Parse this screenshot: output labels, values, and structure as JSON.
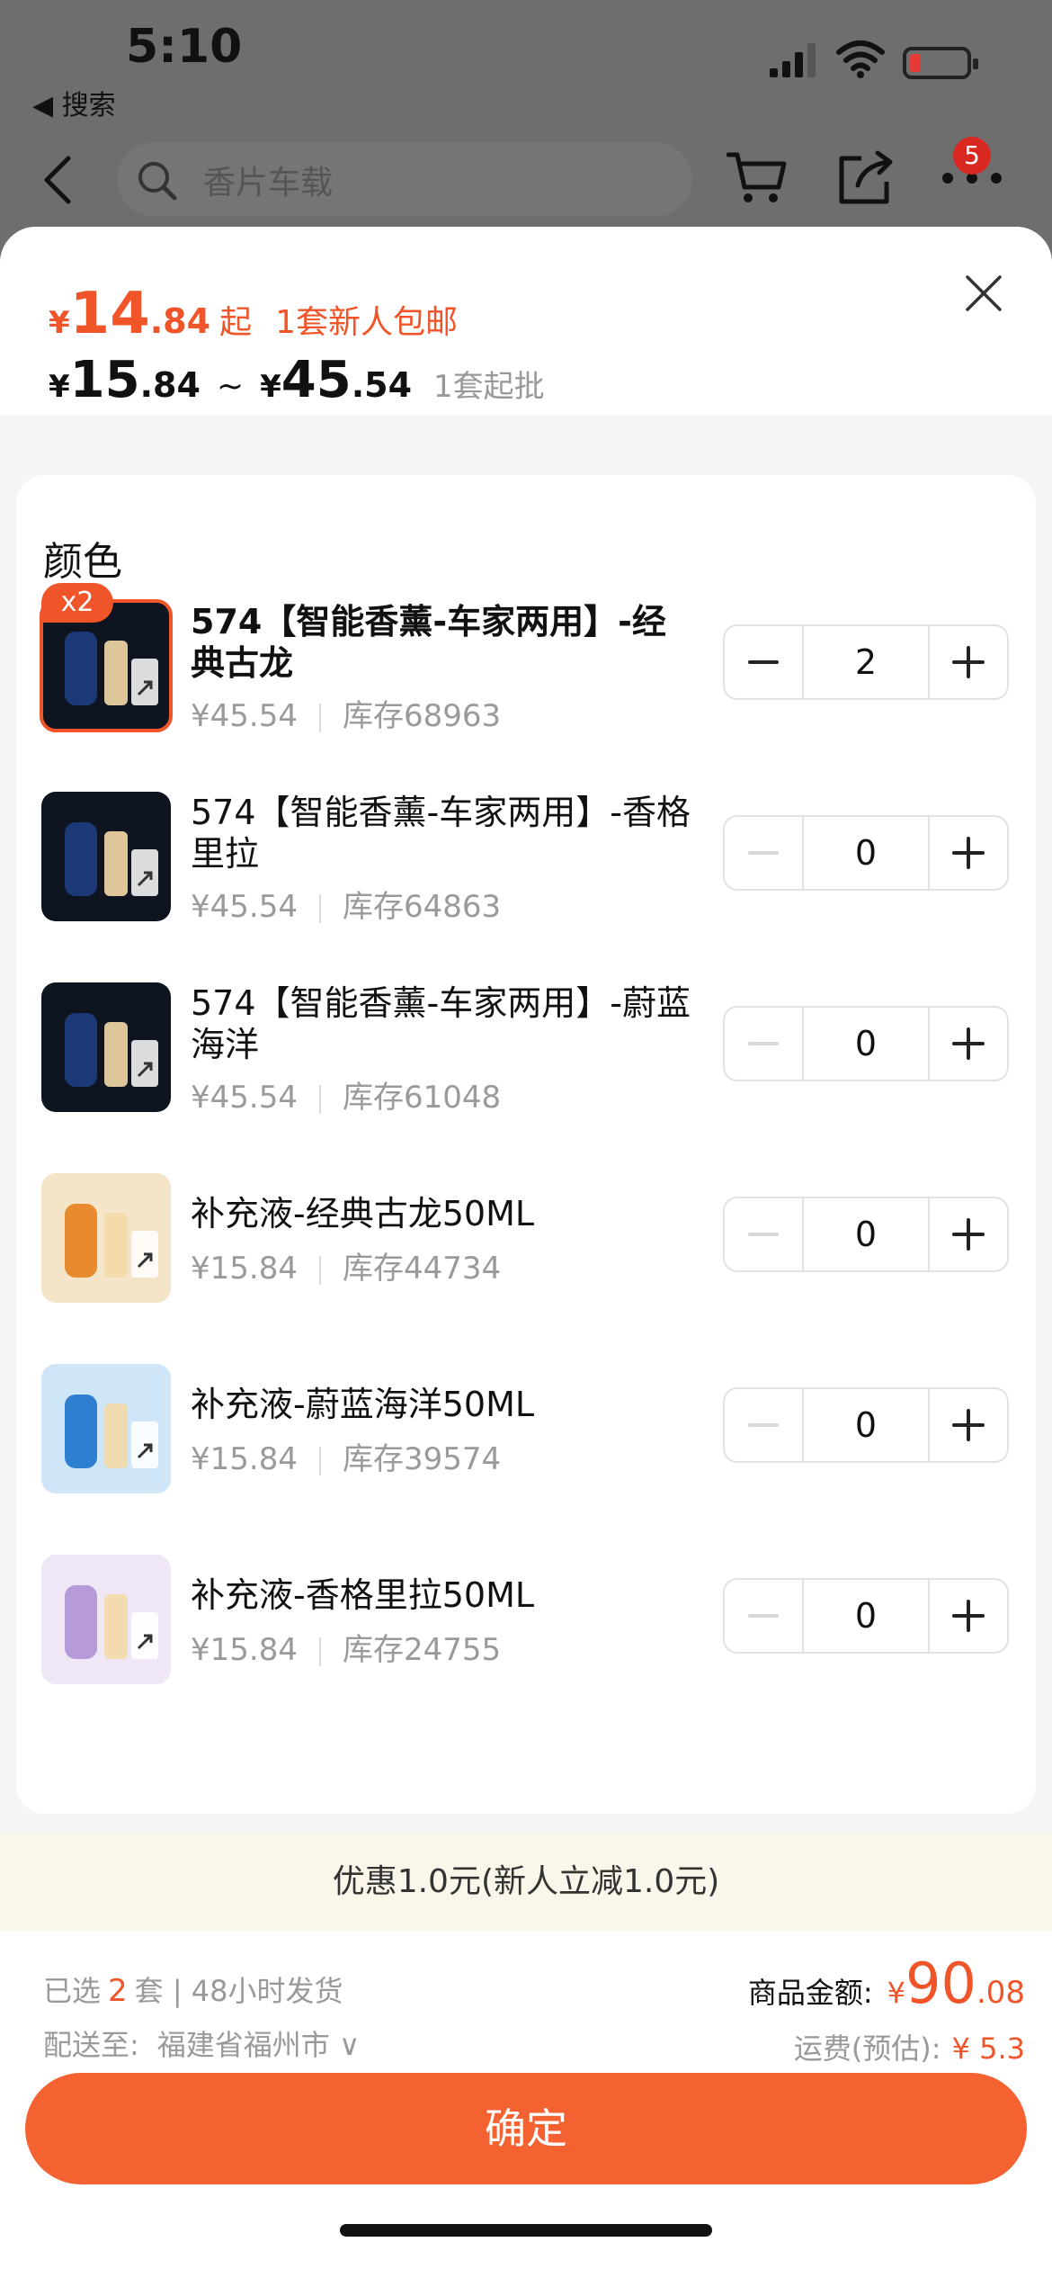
{
  "status": {
    "time": "5:10",
    "back_app": "◀ 搜索"
  },
  "nav": {
    "search_placeholder": "香片车载",
    "badge": "5"
  },
  "price": {
    "yen": "¥",
    "start_int": "14",
    "start_dec": ".84",
    "start_suffix": "起",
    "promo": "1套新人包邮",
    "range_low_int": "15",
    "range_low_dec": ".84",
    "tilde": "~",
    "range_high_int": "45",
    "range_high_dec": ".54",
    "moq": "1套起批"
  },
  "section_title": "颜色",
  "items": [
    {
      "name": "574【智能香薰-车家两用】-经典古龙",
      "price": "¥45.54",
      "stock": "库存68963",
      "qty": "2",
      "badge": "x2",
      "accent": "#1d3a78",
      "bg": "#0e1420"
    },
    {
      "name": "574【智能香薰-车家两用】-香格里拉",
      "price": "¥45.54",
      "stock": "库存64863",
      "qty": "0",
      "accent": "#1d3a78",
      "bg": "#0e1420"
    },
    {
      "name": "574【智能香薰-车家两用】-蔚蓝海洋",
      "price": "¥45.54",
      "stock": "库存61048",
      "qty": "0",
      "accent": "#1d3a78",
      "bg": "#0e1420"
    },
    {
      "name": "补充液-经典古龙50ML",
      "price": "¥15.84",
      "stock": "库存44734",
      "qty": "0",
      "accent": "#e88a2e",
      "bg": "#f4e4c8"
    },
    {
      "name": "补充液-蔚蓝海洋50ML",
      "price": "¥15.84",
      "stock": "库存39574",
      "qty": "0",
      "accent": "#2f7fd0",
      "bg": "#cfe6f8"
    },
    {
      "name": "补充液-香格里拉50ML",
      "price": "¥15.84",
      "stock": "库存24755",
      "qty": "0",
      "accent": "#b79ad8",
      "bg": "#efe6f6"
    }
  ],
  "discount": "优惠1.0元(新人立减1.0元)",
  "footer": {
    "selected_prefix": "已选",
    "selected_num": "2",
    "selected_suffix": "套 | 48小时发货",
    "ship_label": "配送至:",
    "ship_addr": "福建省福州市 ∨",
    "amount_label": "商品金额:",
    "amount_yen": "¥",
    "amount_int": "90",
    "amount_dec": ".08",
    "fee_label": "运费(预估):",
    "fee_value": "¥ 5.3",
    "confirm": "确定"
  },
  "colors": {
    "accent": "#f0552a",
    "button": "#f46231"
  }
}
